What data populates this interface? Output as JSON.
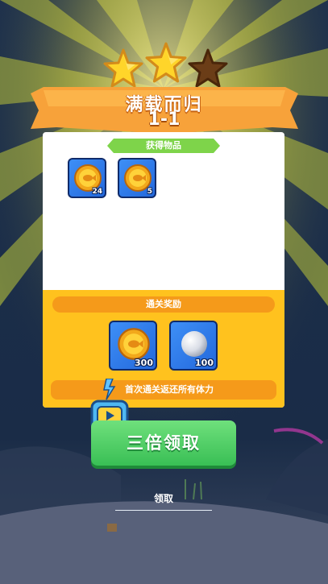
{
  "header": {
    "title": "满载而归",
    "level": "1-1",
    "stars_earned": 2,
    "stars_total": 3
  },
  "obtained": {
    "label": "获得物品",
    "items": [
      {
        "icon": "gold-coin-icon",
        "count": "24"
      },
      {
        "icon": "gold-coin-icon",
        "count": "5"
      }
    ]
  },
  "clear_reward": {
    "label": "通关奖励",
    "items": [
      {
        "icon": "gold-coin-icon",
        "count": "300"
      },
      {
        "icon": "pearl-icon",
        "count": "100"
      }
    ],
    "tip": "首次通关返还所有体力"
  },
  "actions": {
    "triple_label": "三倍领取",
    "claim_label": "领取"
  },
  "colors": {
    "banner": "#f7a23a",
    "star_gold": "#ffd52a",
    "star_empty": "#6b3d17",
    "panel_yellow": "#ffc21e",
    "label_green": "#7ed44a",
    "button_green": "#45c85e"
  }
}
